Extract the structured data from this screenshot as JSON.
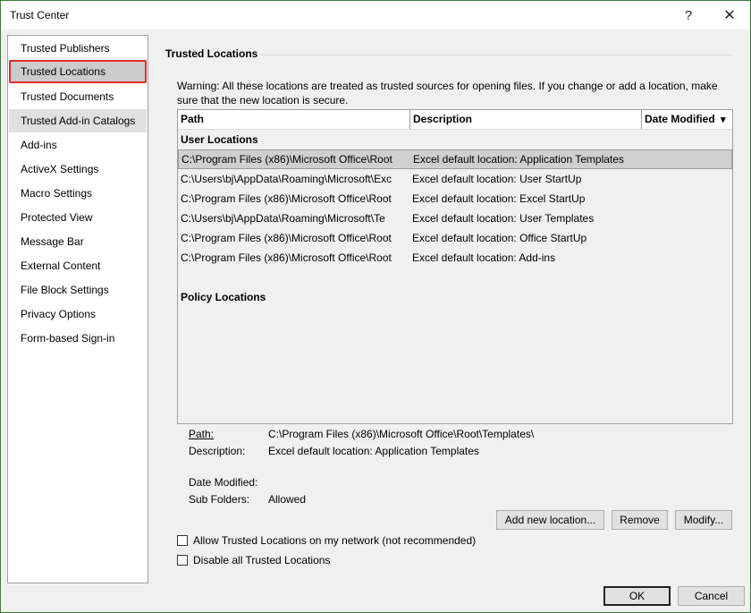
{
  "window": {
    "title": "Trust Center",
    "help_glyph": "?",
    "close_glyph": "✕"
  },
  "sidebar": {
    "items": [
      {
        "label": "Trusted Publishers"
      },
      {
        "label": "Trusted Locations",
        "selected": true
      },
      {
        "label": "Trusted Documents"
      },
      {
        "label": "Trusted Add-in Catalogs"
      },
      {
        "label": "Add-ins"
      },
      {
        "label": "ActiveX Settings"
      },
      {
        "label": "Macro Settings"
      },
      {
        "label": "Protected View"
      },
      {
        "label": "Message Bar"
      },
      {
        "label": "External Content"
      },
      {
        "label": "File Block Settings"
      },
      {
        "label": "Privacy Options"
      },
      {
        "label": "Form-based Sign-in"
      }
    ]
  },
  "main": {
    "title": "Trusted Locations",
    "warning": "Warning: All these locations are treated as trusted sources for opening files.  If you change or add a location, make sure that the new location is secure.",
    "table": {
      "columns": [
        "Path",
        "Description",
        "Date Modified"
      ],
      "sort_glyph": "▾",
      "user_group": "User Locations",
      "rows": [
        {
          "path": "C:\\Program Files (x86)\\Microsoft Office\\Root",
          "description": "Excel default location: Application Templates"
        },
        {
          "path": "C:\\Users\\bj\\AppData\\Roaming\\Microsoft\\Exc",
          "description": "Excel default location: User StartUp"
        },
        {
          "path": "C:\\Program Files (x86)\\Microsoft Office\\Root",
          "description": "Excel default location: Excel StartUp"
        },
        {
          "path": "C:\\Users\\bj\\AppData\\Roaming\\Microsoft\\Te",
          "description": "Excel default location: User Templates"
        },
        {
          "path": "C:\\Program Files (x86)\\Microsoft Office\\Root",
          "description": "Excel default location: Office StartUp"
        },
        {
          "path": "C:\\Program Files (x86)\\Microsoft Office\\Root",
          "description": "Excel default location: Add-ins"
        }
      ],
      "policy_group": "Policy Locations"
    },
    "details": {
      "path_label": "Path:",
      "path_value": "C:\\Program Files (x86)\\Microsoft Office\\Root\\Templates\\",
      "description_label": "Description:",
      "description_value": "Excel default location: Application Templates",
      "date_label": "Date Modified:",
      "subfolders_label": "Sub Folders:",
      "subfolders_value": "Allowed"
    },
    "buttons": {
      "add": "Add new location...",
      "remove": "Remove",
      "modify": "Modify..."
    },
    "checkboxes": {
      "allow_network": {
        "label": "Allow Trusted Locations on my network (not recommended)",
        "checked": false
      },
      "disable_all": {
        "label": "Disable all Trusted Locations",
        "checked": false
      }
    }
  },
  "footer": {
    "ok": "OK",
    "cancel": "Cancel"
  }
}
